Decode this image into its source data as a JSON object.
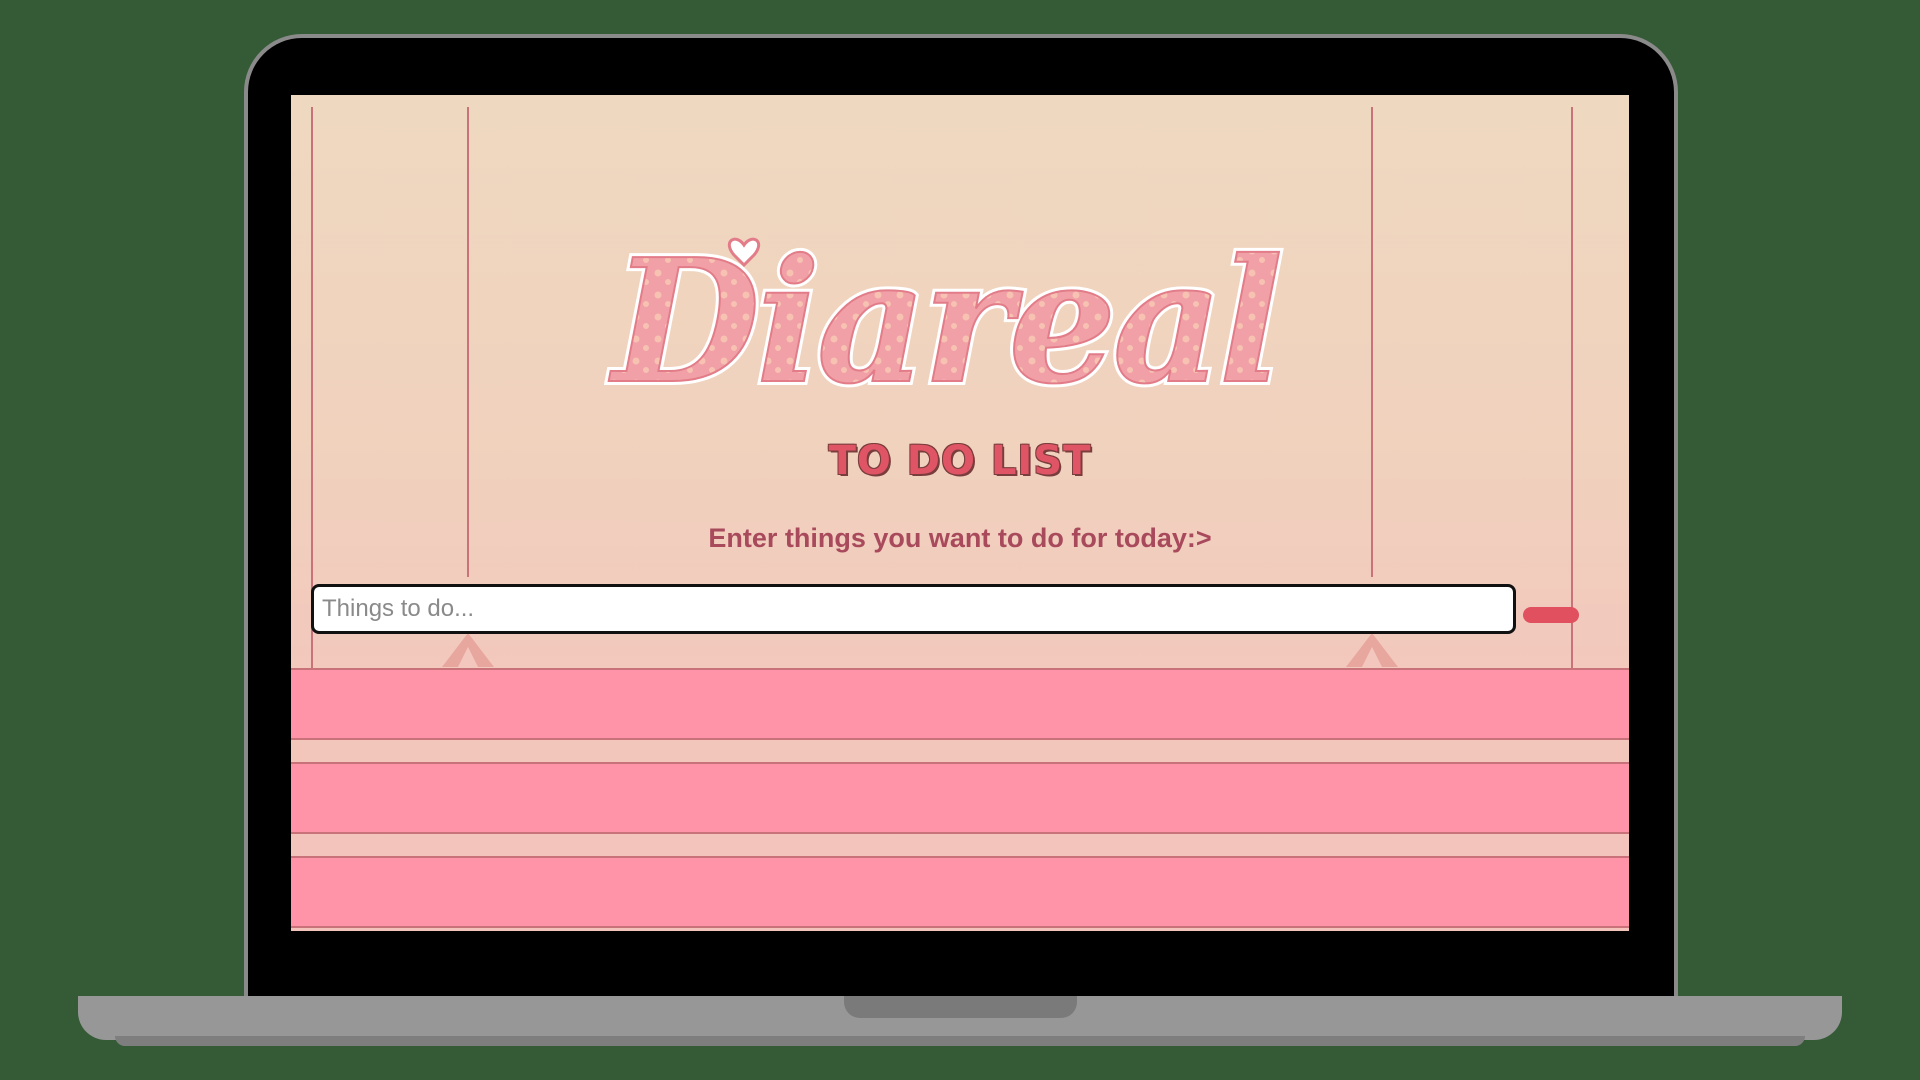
{
  "app": {
    "logo_text": "Diareal",
    "subtitle": "TO DO LIST",
    "prompt": "Enter things you want to do for today:>"
  },
  "input": {
    "placeholder": "Things to do...",
    "value": ""
  },
  "add_button": {
    "label": ""
  },
  "todo_items": [
    {
      "text": ""
    },
    {
      "text": ""
    },
    {
      "text": ""
    }
  ],
  "colors": {
    "background": "#355a36",
    "accent": "#e0505f",
    "list_item": "#ff94a8",
    "title": "#e05565",
    "prompt_text": "#a84a5c"
  }
}
